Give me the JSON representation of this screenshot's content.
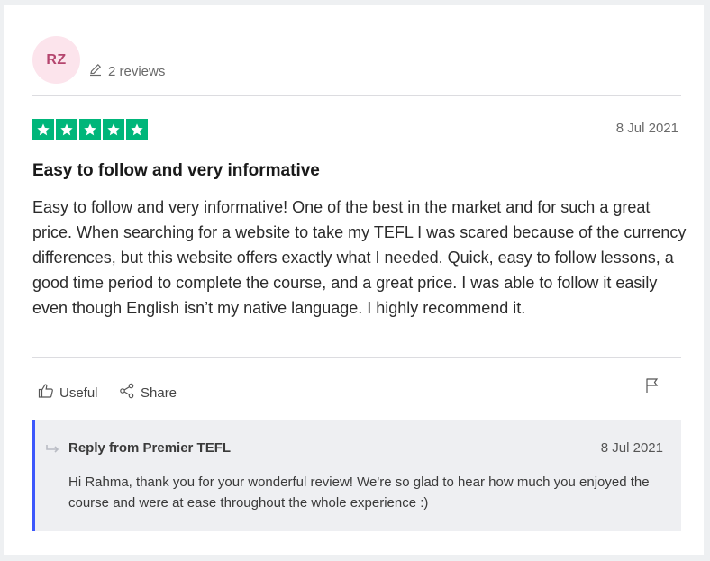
{
  "reviewer": {
    "initials": "RZ",
    "reviews_count": "2 reviews"
  },
  "review": {
    "rating": 5,
    "rating_color": "#00b67a",
    "date": "8 Jul 2021",
    "title": "Easy to follow and very informative",
    "text": "Easy to follow and very informative! One of the best in the market and for such a great price. When searching for a website to take my TEFL I was scared because of the currency differences, but this website offers exactly what I needed. Quick, easy to follow lessons, a good time period to complete the course, and a great price. I was able to follow it easily even though English isn’t my native language. I highly recommend it."
  },
  "actions": {
    "useful_label": "Useful",
    "share_label": "Share",
    "icons": [
      "thumbs-up-icon",
      "share-icon",
      "flag-icon"
    ]
  },
  "reply": {
    "title": "Reply from Premier TEFL",
    "date": "8 Jul 2021",
    "text": "Hi Rahma, thank you for your wonderful review! We're so glad to hear how much you enjoyed the course and were at ease throughout the whole experience :)",
    "accent_color": "#3c57fc"
  }
}
